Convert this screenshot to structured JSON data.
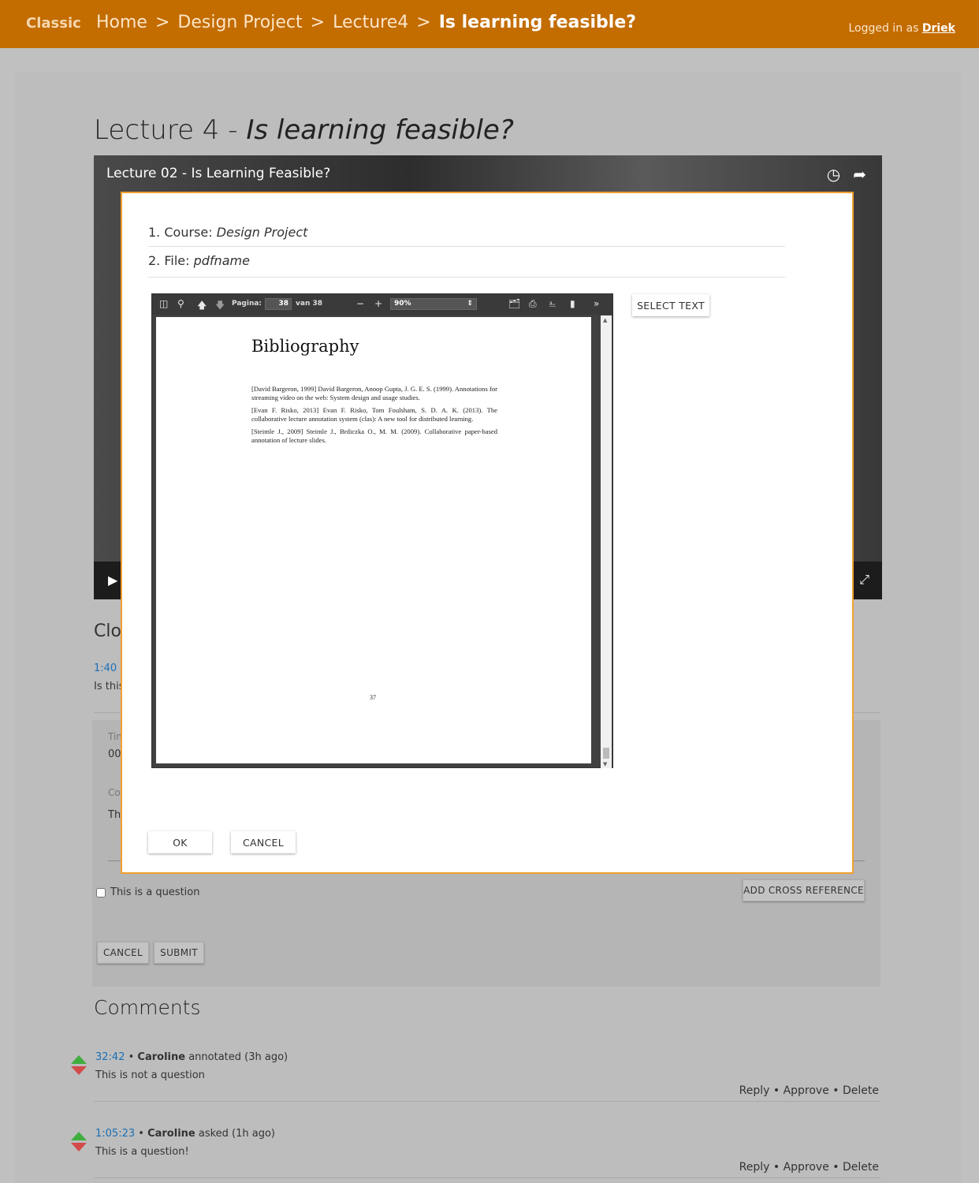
{
  "topbar": {
    "brand": "Classic",
    "breadcrumbs": [
      "Home",
      "Design Project",
      "Lecture4"
    ],
    "separator": ">",
    "current": "Is learning feasible?",
    "logged_in_prefix": "Logged in as",
    "user": "Driek"
  },
  "page": {
    "title_prefix": "Lecture 4 -",
    "title_italic": "Is learning feasible?"
  },
  "video": {
    "title": "Lecture 02 - Is Learning Feasible?",
    "icons": [
      "clock-icon",
      "share-icon",
      "play-icon",
      "fullscreen-icon"
    ]
  },
  "background": {
    "closed_heading_partial": "Clo",
    "timestamp_partial": "1:40 •",
    "text_partial": "Is this",
    "time_label_partial": "Tin",
    "time_value_partial": "00",
    "comment_label_partial": "Co",
    "comment_value_partial": "Th"
  },
  "form": {
    "question_checkbox_label": "This is a question",
    "question_checked": false,
    "add_cross_reference": "ADD CROSS REFERENCE",
    "cancel": "CANCEL",
    "submit": "SUBMIT"
  },
  "comments": {
    "heading": "Comments",
    "items": [
      {
        "timestamp": "32:42",
        "author": "Caroline",
        "action": "annotated (3h ago)",
        "text": "This is not a question"
      },
      {
        "timestamp": "1:05:23",
        "author": "Caroline",
        "action": "asked (1h ago)",
        "text": "This is a question!"
      }
    ],
    "actions": {
      "reply": "Reply",
      "approve": "Approve",
      "delete": "Delete",
      "bullet": "•"
    }
  },
  "modal": {
    "course_label": "1. Course:",
    "course_value": "Design Project",
    "file_label": "2. File:",
    "file_value": "pdfname",
    "select_text": "SELECT TEXT",
    "ok": "OK",
    "cancel": "CANCEL"
  },
  "pdf_viewer": {
    "page_label": "Pagina:",
    "page_value": "38",
    "page_total": "van 38",
    "zoom": "90%",
    "page_heading": "Bibliography",
    "references": [
      "[David Bargeron, 1999] David Bargeron, Anoop Gupta, J. G. E. S. (1999). Annotations for streaming video on the web: System design and usage studies.",
      "[Evan F. Risko, 2013] Evan F. Risko, Tom Foulsham, S. D. A. K. (2013). The collaborative lecture annotation system (clas): A new tool for distributed learning.",
      "[Steimle J., 2009] Steimle J., Brdiczka O., M. M. (2009). Collaborative paper-based annotation of lecture slides."
    ],
    "page_number": "37"
  }
}
